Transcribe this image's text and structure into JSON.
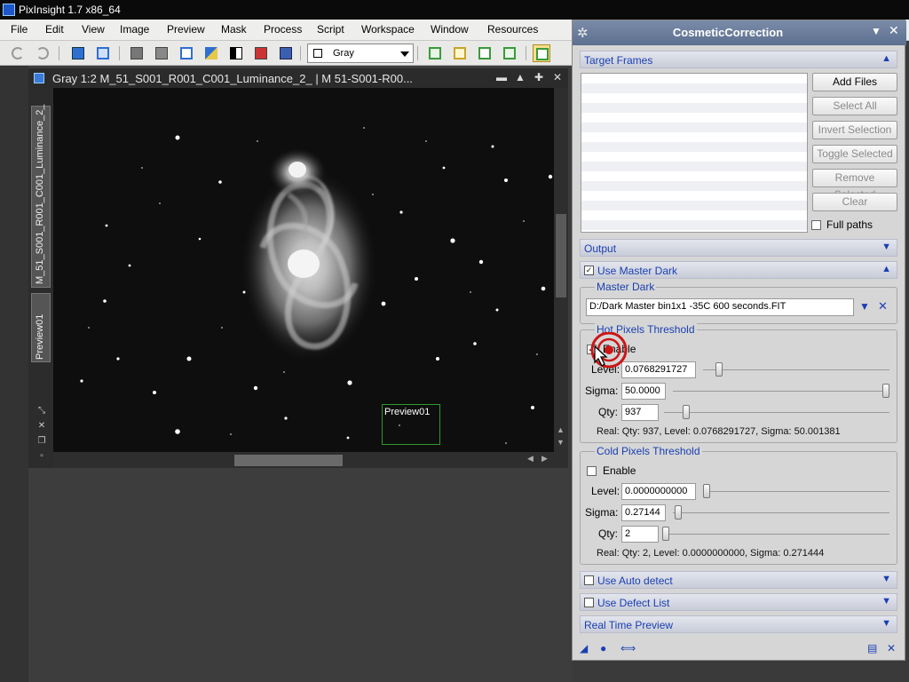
{
  "app": {
    "title": "PixInsight 1.7 x86_64"
  },
  "menu": [
    "File",
    "Edit",
    "View",
    "Image",
    "Preview",
    "Mask",
    "Process",
    "Script",
    "Workspace",
    "Window",
    "Resources"
  ],
  "toolbar": {
    "view_select": "Gray"
  },
  "image_window": {
    "title": "Gray 1:2 M_51_S001_R001_C001_Luminance_2_ | M 51-S001-R00...",
    "tabs": [
      "M_51_S001_R001_C001_Luminance_2_",
      "Preview01"
    ],
    "preview_label": "Preview01"
  },
  "panel": {
    "title": "CosmeticCorrection",
    "target_frames": {
      "label": "Target Frames",
      "buttons": [
        "Add Files",
        "Select All",
        "Invert Selection",
        "Toggle Selected",
        "Remove Selected",
        "Clear"
      ],
      "full_paths": "Full paths"
    },
    "output_label": "Output",
    "use_master_dark": "Use Master Dark",
    "master_dark": {
      "label": "Master Dark",
      "path": "D:/Dark Master bin1x1 -35C 600 seconds.FIT"
    },
    "hot": {
      "label": "Hot Pixels Threshold",
      "enable": "Enable",
      "level_label": "Level:",
      "level": "0.0768291727",
      "sigma_label": "Sigma:",
      "sigma": "50.0000",
      "qty_label": "Qty:",
      "qty": "937",
      "real": "Real: Qty: 937, Level: 0.0768291727, Sigma: 50.001381"
    },
    "cold": {
      "label": "Cold Pixels Threshold",
      "enable": "Enable",
      "level_label": "Level:",
      "level": "0.0000000000",
      "sigma_label": "Sigma:",
      "sigma": "0.27144",
      "qty_label": "Qty:",
      "qty": "2",
      "real": "Real: Qty: 2, Level: 0.0000000000, Sigma: 0.271444"
    },
    "use_auto_detect": "Use Auto detect",
    "use_defect_list": "Use Defect List",
    "real_time_preview": "Real Time Preview"
  },
  "colors": {
    "accent": "#1a3fb2",
    "titlebar": "#5d7090",
    "workspace": "#3d3d3d",
    "preview_box": "#2d9a2d"
  }
}
